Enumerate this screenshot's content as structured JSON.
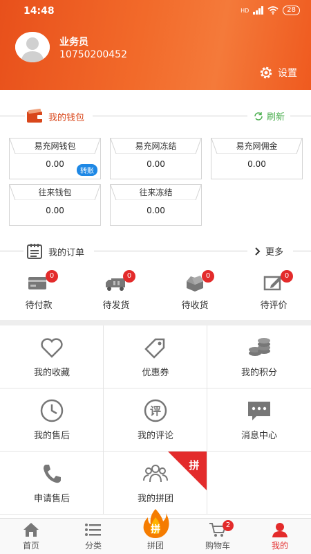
{
  "status_bar": {
    "time": "14:48",
    "network": "HD",
    "battery": "28"
  },
  "header": {
    "user_role": "业务员",
    "user_phone": "10750200452",
    "settings_label": "设置",
    "accent": "#ef5a1f"
  },
  "wallet": {
    "title": "我的钱包",
    "refresh_label": "刷新",
    "transfer_label": "转账",
    "cards": [
      {
        "label": "易充网钱包",
        "value": "0.00"
      },
      {
        "label": "易充网冻结",
        "value": "0.00"
      },
      {
        "label": "易充网佣金",
        "value": "0.00"
      },
      {
        "label": "往来钱包",
        "value": "0.00"
      },
      {
        "label": "往来冻结",
        "value": "0.00"
      }
    ]
  },
  "orders": {
    "title": "我的订单",
    "more_label": "更多",
    "items": [
      {
        "label": "待付款",
        "count": "0",
        "icon": "card-icon"
      },
      {
        "label": "待发货",
        "count": "0",
        "icon": "truck-icon"
      },
      {
        "label": "待收货",
        "count": "0",
        "icon": "box-icon"
      },
      {
        "label": "待评价",
        "count": "0",
        "icon": "edit-icon"
      }
    ]
  },
  "grid": [
    {
      "label": "我的收藏",
      "icon": "heart-icon"
    },
    {
      "label": "优惠券",
      "icon": "tag-icon"
    },
    {
      "label": "我的积分",
      "icon": "coins-icon"
    },
    {
      "label": "我的售后",
      "icon": "clock-icon"
    },
    {
      "label": "我的评论",
      "icon": "review-icon",
      "icon_text": "评"
    },
    {
      "label": "消息中心",
      "icon": "message-icon"
    },
    {
      "label": "申请售后",
      "icon": "phone-icon"
    },
    {
      "label": "我的拼团",
      "icon": "group-icon",
      "ribbon": "拼"
    }
  ],
  "tabbar": {
    "items": [
      {
        "label": "首页",
        "icon": "home-icon"
      },
      {
        "label": "分类",
        "icon": "list-icon"
      },
      {
        "label": "拼团",
        "icon": "flame-icon",
        "icon_text": "拼"
      },
      {
        "label": "购物车",
        "icon": "cart-icon",
        "badge": "2"
      },
      {
        "label": "我的",
        "icon": "person-icon",
        "active": true
      }
    ],
    "active_color": "#e32b2b"
  }
}
